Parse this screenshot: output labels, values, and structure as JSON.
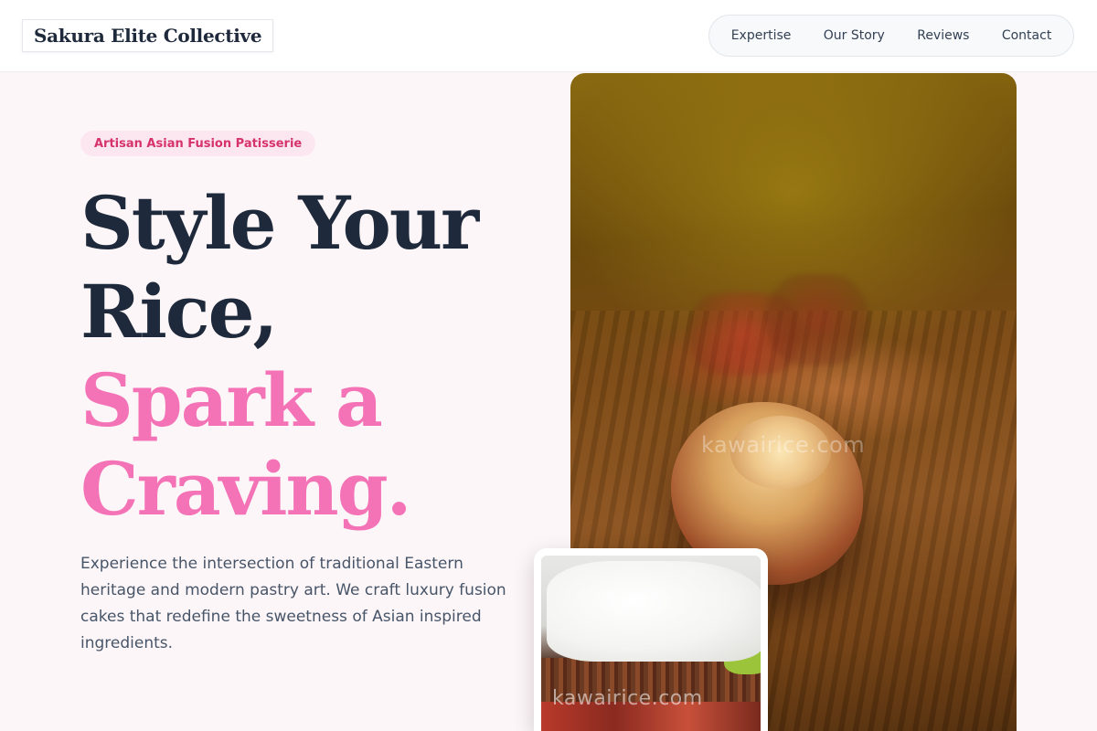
{
  "brand": {
    "name": "Sakura Elite Collective"
  },
  "nav": {
    "items": [
      {
        "label": "Expertise"
      },
      {
        "label": "Our Story"
      },
      {
        "label": "Reviews"
      },
      {
        "label": "Contact"
      }
    ]
  },
  "hero": {
    "badge": "Artisan Asian Fusion Patisserie",
    "headline_line1": "Style Your",
    "headline_line2": "Rice,",
    "headline_line3": "Spark a",
    "headline_line4": "Craving.",
    "description": "Experience the intersection of traditional Eastern heritage and modern pastry art. We craft luxury fusion cakes that redefine the sweetness of Asian inspired ingredients."
  },
  "images": {
    "main_watermark": "kawairice.com",
    "thumb_watermark": "kawairice.com"
  },
  "colors": {
    "dark_text": "#1e293b",
    "accent_pink": "#f472b6",
    "badge_text": "#d6336c",
    "badge_bg": "#fce7f0",
    "page_bg": "#fdf6f8"
  }
}
